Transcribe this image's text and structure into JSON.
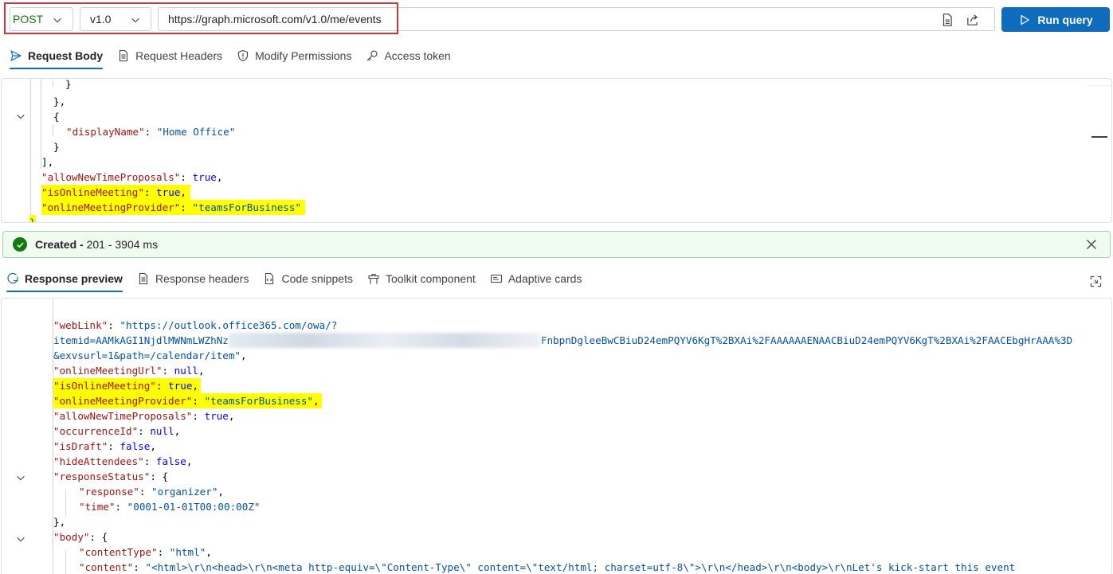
{
  "request_bar": {
    "method": "POST",
    "version": "v1.0",
    "url": "https://graph.microsoft.com/v1.0/me/events",
    "run_label": "Run query"
  },
  "request_tabs": [
    {
      "label": "Request Body",
      "icon": "send-icon"
    },
    {
      "label": "Request Headers",
      "icon": "document-icon"
    },
    {
      "label": "Modify Permissions",
      "icon": "shield-icon"
    },
    {
      "label": "Access token",
      "icon": "key-icon"
    }
  ],
  "request_body": {
    "lines": [
      {
        "text": "}"
      },
      {
        "text": "},"
      },
      {
        "text": "{"
      },
      {
        "key": "\"displayName\"",
        "value": "\"Home Office\""
      },
      {
        "text": "}"
      },
      {
        "text": "],"
      },
      {
        "key": "\"allowNewTimeProposals\"",
        "value": "true",
        "trail": ","
      },
      {
        "key": "\"isOnlineMeeting\"",
        "value": "true",
        "trail": ","
      },
      {
        "key": "\"onlineMeetingProvider\"",
        "value": "\"teamsForBusiness\""
      },
      {
        "text": "}"
      }
    ]
  },
  "status": {
    "title": "Created",
    "detail": "201 - 3904 ms"
  },
  "response_tabs": [
    {
      "label": "Response preview",
      "icon": "response-icon"
    },
    {
      "label": "Response headers",
      "icon": "document-icon"
    },
    {
      "label": "Code snippets",
      "icon": "code-icon"
    },
    {
      "label": "Toolkit component",
      "icon": "toolkit-icon"
    },
    {
      "label": "Adaptive cards",
      "icon": "card-icon"
    }
  ],
  "response_body": {
    "weblink_key": "\"webLink\"",
    "weblink_line1": "\"https://outlook.office365.com/owa/?",
    "weblink_line2_start": "itemid=AAMkAGI1NjdlMWNmLWZhNz",
    "weblink_line2_end": "FnbpnDgleeBwCBiuD24emPQYV6KgT%2BXAi%2FAAAAAAENAACBiuD24emPQYV6KgT%2BXAi%2FAACEbgHrAAA%3D",
    "weblink_line3": "&exvsurl=1&path=/calendar/item\"",
    "fields": [
      {
        "key": "\"onlineMeetingUrl\"",
        "value": "null"
      },
      {
        "key": "\"isOnlineMeeting\"",
        "value": "true"
      },
      {
        "key": "\"onlineMeetingProvider\"",
        "value": "\"teamsForBusiness\""
      },
      {
        "key": "\"allowNewTimeProposals\"",
        "value": "true"
      },
      {
        "key": "\"occurrenceId\"",
        "value": "null"
      },
      {
        "key": "\"isDraft\"",
        "value": "false"
      },
      {
        "key": "\"hideAttendees\"",
        "value": "false"
      }
    ],
    "response_status_key": "\"responseStatus\"",
    "response_key": "\"response\"",
    "response_value": "\"organizer\"",
    "time_key": "\"time\"",
    "time_value": "\"0001-01-01T00:00:00Z\"",
    "body_key": "\"body\"",
    "content_type_key": "\"contentType\"",
    "content_type_value": "\"html\"",
    "content_key": "\"content\"",
    "content_value": "\"<html>\\r\\n<head>\\r\\n<meta http-equiv=\\\"Content-Type\\\" content=\\\"text/html; charset=utf-8\\\">\\r\\n</head>\\r\\n<body>\\r\\nLet's kick-start this event"
  }
}
